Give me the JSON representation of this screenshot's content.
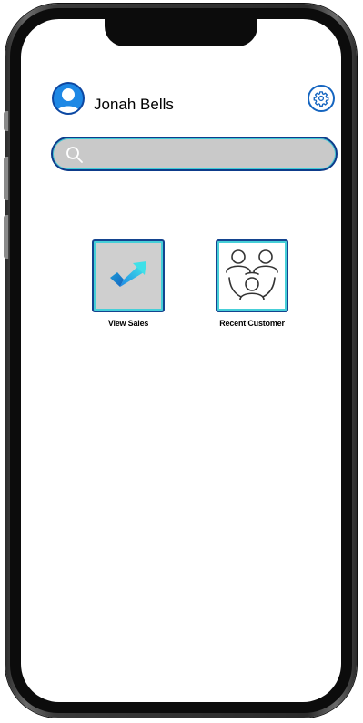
{
  "user": {
    "name": "Jonah Bells"
  },
  "search": {
    "placeholder": ""
  },
  "tiles": [
    {
      "label": "View Sales",
      "icon": "sales-check-arrow-icon"
    },
    {
      "label": "Recent Customer",
      "icon": "customer-group-icon"
    }
  ],
  "colors": {
    "accent_blue": "#1e88e5",
    "border_navy": "#14448f",
    "accent_cyan": "#46cfd8",
    "tile_gray": "#cfcfcf"
  }
}
